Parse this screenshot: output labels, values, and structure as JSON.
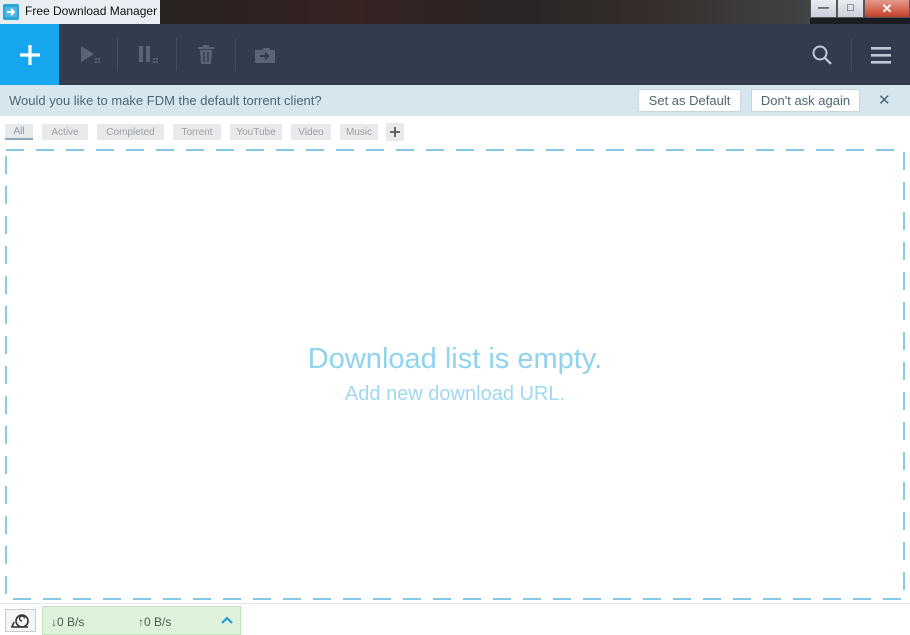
{
  "window": {
    "title": "Free Download Manager",
    "minimize": "—",
    "maximize": "□",
    "close": "✕"
  },
  "toolbar": {
    "add_icon": "plus-icon",
    "start_icon": "play-icon",
    "pause_icon": "pause-icon",
    "delete_icon": "trash-icon",
    "move_icon": "folder-move-icon",
    "search_icon": "search-icon",
    "menu_icon": "hamburger-menu-icon",
    "accent": "#16a6ed",
    "background": "#333b4e"
  },
  "banner": {
    "message": "Would you like to make FDM the default torrent client?",
    "set_default_label": "Set as Default",
    "dont_ask_label": "Don't ask again",
    "close_label": "✕"
  },
  "filters": {
    "tabs": [
      {
        "label": "All",
        "active": true
      },
      {
        "label": "Active",
        "active": false
      },
      {
        "label": "Completed",
        "active": false
      },
      {
        "label": "Torrent",
        "active": false
      },
      {
        "label": "YouTube",
        "active": false
      },
      {
        "label": "Video",
        "active": false
      },
      {
        "label": "Music",
        "active": false
      }
    ],
    "add_icon": "plus-icon"
  },
  "main": {
    "empty_title": "Download list is empty.",
    "empty_subtitle": "Add new download URL."
  },
  "status": {
    "snail_icon": "snail-icon",
    "download_speed": "↓0 B/s",
    "upload_speed": "↑0 B/s",
    "expand_icon": "chevron-up-icon"
  }
}
